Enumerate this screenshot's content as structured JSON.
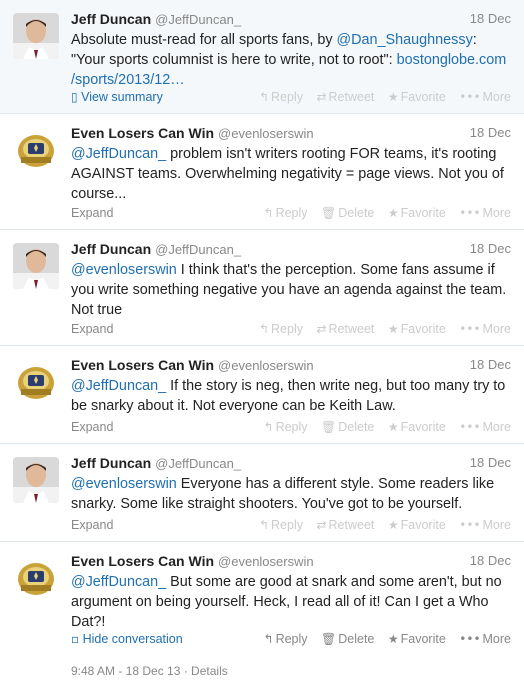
{
  "tweets": [
    {
      "name": "Jeff Duncan",
      "handle": "@JeffDuncan_",
      "date": "18 Dec",
      "parts": [
        {
          "t": "Absolute must-read for all sports fans, by ",
          "link": false
        },
        {
          "t": "@Dan_Shaughnessy",
          "link": true
        },
        {
          "t": ": \"Your sports columnist is here to write, not to root\": ",
          "link": false
        },
        {
          "t": "bostonglobe.com /sports/2013/12…",
          "link": true
        }
      ],
      "expand": "View summary",
      "actions": [
        "Reply",
        "Retweet",
        "Favorite",
        "More"
      ]
    },
    {
      "name": "Even Losers Can Win",
      "handle": "@evenloserswin",
      "date": "18 Dec",
      "parts": [
        {
          "t": "@JeffDuncan_",
          "link": true
        },
        {
          "t": " problem isn't writers rooting FOR teams, it's rooting AGAINST teams. Overwhelming negativity = page views. Not you of course...",
          "link": false
        }
      ],
      "expand": "Expand",
      "actions": [
        "Reply",
        "Delete",
        "Favorite",
        "More"
      ]
    },
    {
      "name": "Jeff Duncan",
      "handle": "@JeffDuncan_",
      "date": "18 Dec",
      "parts": [
        {
          "t": "@evenloserswin",
          "link": true
        },
        {
          "t": " I think that's the perception. Some fans assume if you write something negative you have an agenda against the team. Not true",
          "link": false
        }
      ],
      "expand": "Expand",
      "actions": [
        "Reply",
        "Retweet",
        "Favorite",
        "More"
      ]
    },
    {
      "name": "Even Losers Can Win",
      "handle": "@evenloserswin",
      "date": "18 Dec",
      "parts": [
        {
          "t": "@JeffDuncan_",
          "link": true
        },
        {
          "t": " If the story is neg, then write neg, but too many try to be snarky about it. Not everyone can be Keith Law.",
          "link": false
        }
      ],
      "expand": "Expand",
      "actions": [
        "Reply",
        "Delete",
        "Favorite",
        "More"
      ]
    },
    {
      "name": "Jeff Duncan",
      "handle": "@JeffDuncan_",
      "date": "18 Dec",
      "parts": [
        {
          "t": "@evenloserswin",
          "link": true
        },
        {
          "t": " Everyone has a different style. Some readers like snarky. Some like straight shooters. You've got to be yourself.",
          "link": false
        }
      ],
      "expand": "Expand",
      "actions": [
        "Reply",
        "Retweet",
        "Favorite",
        "More"
      ]
    },
    {
      "name": "Even Losers Can Win",
      "handle": "@evenloserswin",
      "date": "18 Dec",
      "parts": [
        {
          "t": "@JeffDuncan_",
          "link": true
        },
        {
          "t": " But some are good at snark and some aren't, but no argument on being yourself. Heck, I read all of it! Can I get a Who Dat?!",
          "link": false
        }
      ],
      "expand": "Hide conversation",
      "actions": [
        "Reply",
        "Delete",
        "Favorite",
        "More"
      ],
      "timestamp": "9:48 AM - 18 Dec 13 · Details"
    }
  ]
}
